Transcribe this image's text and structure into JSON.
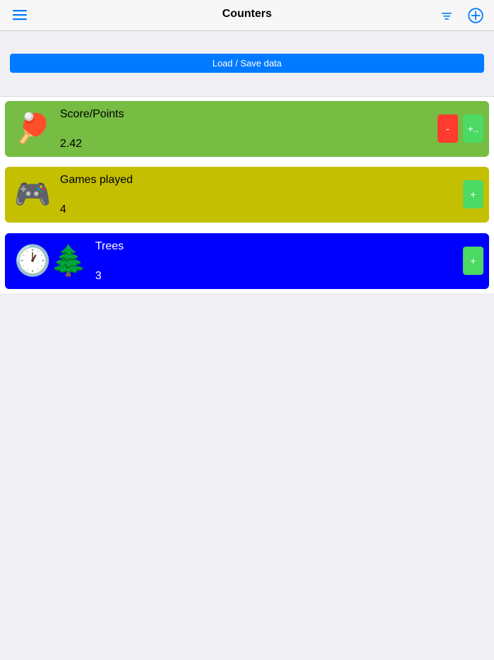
{
  "header": {
    "title": "Counters",
    "left_icon": "menu-icon",
    "right_icons": [
      "filter-icon",
      "add-icon"
    ],
    "accent_color": "#007aff"
  },
  "load_save": {
    "label": "Load / Save data",
    "color": "#007aff"
  },
  "counters": [
    {
      "name": "Score/Points",
      "value": "2.42",
      "icons": [
        "🏓"
      ],
      "icon_names": [
        "ping-pong-icon"
      ],
      "bg_color": "#77bc43",
      "text_color": "#000000",
      "buttons": [
        "-",
        "+.."
      ]
    },
    {
      "name": "Games played",
      "value": "4",
      "icons": [
        "🎮"
      ],
      "icon_names": [
        "game-controller-icon"
      ],
      "bg_color": "#c4bf00",
      "text_color": "#000000",
      "buttons": [
        "+"
      ]
    },
    {
      "name": "Trees",
      "value": "3",
      "icons": [
        "🕐",
        "🌲"
      ],
      "icon_names": [
        "clock-icon",
        "evergreen-tree-icon"
      ],
      "bg_color": "#0000ff",
      "text_color": "#ffffff",
      "buttons": [
        "+"
      ]
    }
  ],
  "button_colors": {
    "minus": "#ff3b30",
    "plus": "#4cd964"
  }
}
